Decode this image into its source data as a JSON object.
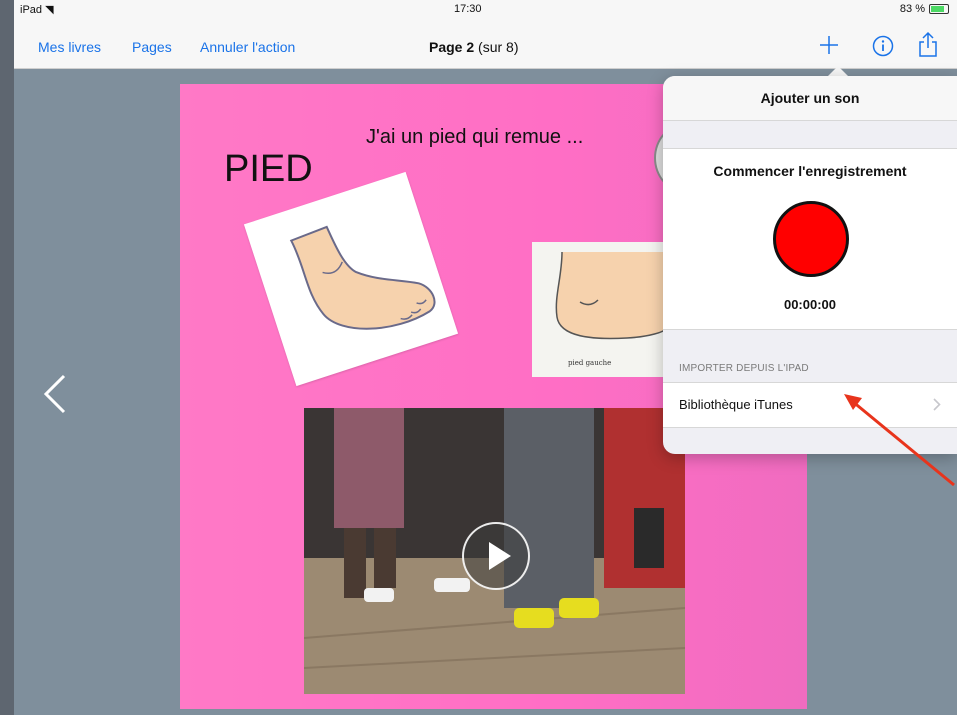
{
  "status_bar": {
    "device": "iPad",
    "time": "17:30",
    "battery": "83 %"
  },
  "toolbar": {
    "my_books": "Mes livres",
    "pages": "Pages",
    "undo": "Annuler l'action",
    "page_title_bold": "Page 2",
    "page_title_rest": "(sur 8)"
  },
  "page": {
    "heading": "PIED",
    "caption": "J'ai un pied qui remue ...",
    "image_label": "pied gauche"
  },
  "popover": {
    "title": "Ajouter un son",
    "record_title": "Commencer l'enregistrement",
    "record_time": "00:00:00",
    "import_header": "IMPORTER DEPUIS L'IPAD",
    "itunes_label": "Bibliothèque iTunes"
  },
  "colors": {
    "accent": "#1a73e8",
    "record": "#ff0000",
    "page_bg": "#ff79c6",
    "annotation_arrow": "#e8341c"
  }
}
